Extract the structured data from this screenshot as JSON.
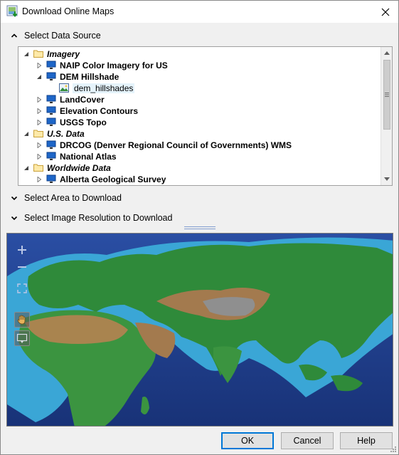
{
  "window": {
    "title": "Download Online Maps",
    "close_icon": "close-icon"
  },
  "sections": {
    "data_source": "Select Data Source",
    "area": "Select Area to Download",
    "resolution": "Select Image Resolution to Download"
  },
  "tree": {
    "rows": [
      {
        "kind": "category",
        "label": "Imagery",
        "expanded": true
      },
      {
        "kind": "server",
        "label": "NAIP Color Imagery for US",
        "expanded": false
      },
      {
        "kind": "server",
        "label": "DEM Hillshade",
        "expanded": true
      },
      {
        "kind": "layer",
        "label": "dem_hillshades",
        "selected": true
      },
      {
        "kind": "server",
        "label": "LandCover",
        "expanded": false
      },
      {
        "kind": "server",
        "label": "Elevation Contours",
        "expanded": false
      },
      {
        "kind": "server",
        "label": "USGS Topo",
        "expanded": false
      },
      {
        "kind": "category",
        "label": "U.S. Data",
        "expanded": true
      },
      {
        "kind": "server",
        "label": "DRCOG (Denver Regional Council of Governments) WMS",
        "expanded": false
      },
      {
        "kind": "server",
        "label": "National Atlas",
        "expanded": false
      },
      {
        "kind": "category",
        "label": "Worldwide Data",
        "expanded": true
      },
      {
        "kind": "server",
        "label": "Alberta Geological Survey",
        "expanded": false
      }
    ]
  },
  "map": {
    "controls": [
      "zoom-in-icon",
      "zoom-out-icon",
      "zoom-extent-icon",
      "pan-hand-icon",
      "select-rectangle-icon"
    ],
    "colors": {
      "ocean_deep": "#1e3a8c",
      "ocean_shelf": "#3aa6d6",
      "lowland": "#2f8a3a",
      "highland": "#a37a4e",
      "mountain": "#8a8a8a"
    }
  },
  "buttons": {
    "ok": "OK",
    "cancel": "Cancel",
    "help": "Help"
  }
}
